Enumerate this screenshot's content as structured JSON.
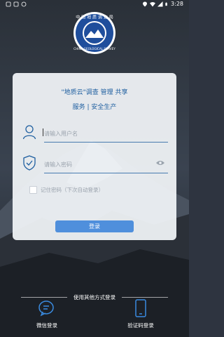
{
  "status_bar": {
    "time": "3:28"
  },
  "slogan": {
    "line1": "\"地质云\"调查 管理 共享",
    "line2": "服务 | 安全生产"
  },
  "username": {
    "placeholder": "请输入用户名"
  },
  "password": {
    "placeholder": "请输入密码"
  },
  "remember": {
    "label": "记住密码（下次自动登录）",
    "checked": false
  },
  "login_button": {
    "label": "登录"
  },
  "other_login": {
    "title": "使用其他方式登录",
    "options": [
      {
        "label": "微信登录",
        "icon": "wechat-icon"
      },
      {
        "label": "验证码登录",
        "icon": "phone-icon"
      }
    ]
  },
  "colors": {
    "accent": "#1f5fa0",
    "button": "#4f8fdc"
  }
}
